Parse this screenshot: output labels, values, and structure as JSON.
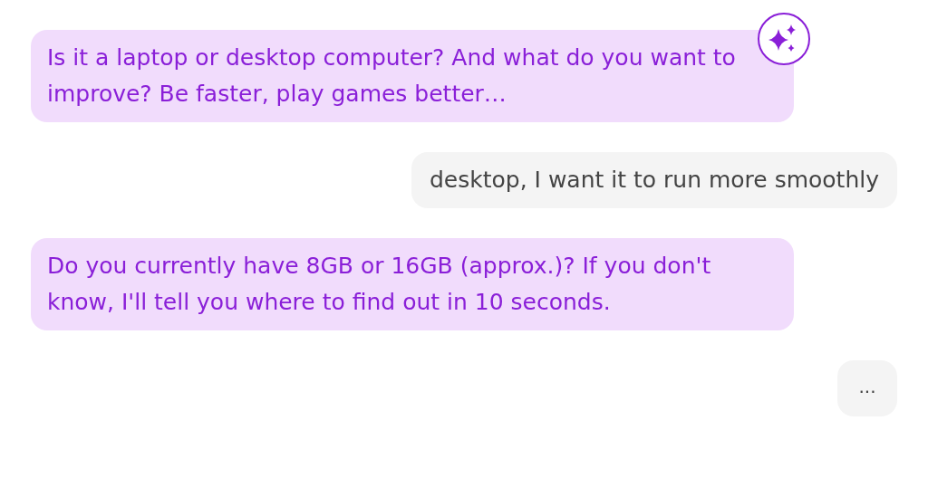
{
  "messages": [
    {
      "kind": "bot",
      "text": "Is it a laptop or desktop computer? And what do you want to improve? Be faster, play games better…",
      "avatar": true
    },
    {
      "kind": "user",
      "text": "desktop, I want it to run more smoothly",
      "avatar": false
    },
    {
      "kind": "bot",
      "text": "Do you currently have 8GB or 16GB (approx.)? If you don't know, I'll tell you where to find out in 10 seconds.",
      "avatar": false
    },
    {
      "kind": "user",
      "text": "...",
      "avatar": false
    }
  ]
}
